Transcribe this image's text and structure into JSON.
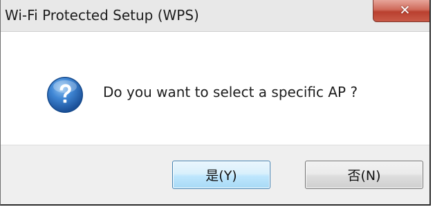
{
  "window": {
    "title": "Wi-Fi Protected Setup (WPS)",
    "close_glyph": "✕"
  },
  "message": {
    "icon": "question-icon",
    "text": "Do you want to select a specific AP ?"
  },
  "buttons": {
    "yes_label": "是(Y)",
    "no_label": "否(N)"
  },
  "colors": {
    "close_button": "#c75a4a",
    "default_button_border": "#3c7fb1",
    "icon_blue": "#1f5fb0",
    "footer_bg": "#efefef"
  }
}
